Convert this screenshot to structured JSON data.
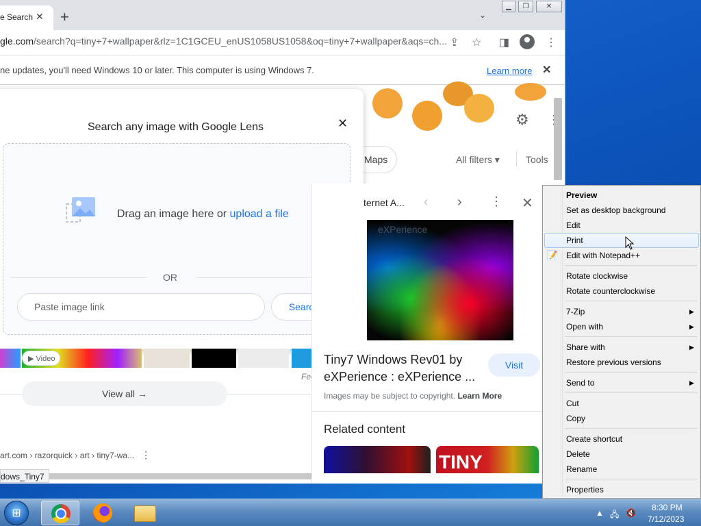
{
  "browser": {
    "tab_title": "e Search",
    "tab_close": "✕",
    "new_tab": "+",
    "url_host": "gle.com",
    "url_rest": "/search?q=tiny+7+wallpaper&rlz=1C1GCEU_enUS1058US1058&oq=tiny+7+wallpaper&aqs=ch...",
    "infobar_message": "ne updates, you'll need Windows 10 or later. This computer is using Windows 7.",
    "infobar_learn_more": "Learn more",
    "infobar_close": "✕"
  },
  "search_page": {
    "maps_chip": "Maps",
    "all_filters": "All filters ▾",
    "tools": "Tools",
    "lens": {
      "title": "Search any image with Google Lens",
      "drag_text": "Drag an image here or ",
      "upload_link": "upload a file",
      "or_text": "OR",
      "paste_placeholder": "Paste image link",
      "search_button": "Search"
    },
    "video_badge": "▶ Video",
    "feed_text": "Fee",
    "view_all": "View all  →",
    "cite": "art.com › razorquick › art › tiny7-wa...",
    "status_bubble": "dows_Tiny7"
  },
  "side_panel": {
    "source": "ternet A...",
    "watermark": "eXPerience",
    "title": "Tiny7 Windows Rev01 by eXPerience : eXPerience ...",
    "visit_button": "Visit",
    "copyright": "Images may be subject to copyright. ",
    "learn_more": "Learn More",
    "related_heading": "Related content",
    "related_2_text": "TINY"
  },
  "context_menu": {
    "items": [
      {
        "label": "Preview",
        "bold": true
      },
      {
        "label": "Set as desktop background"
      },
      {
        "label": "Edit"
      },
      {
        "label": "Print",
        "highlighted": true
      },
      {
        "label": "Edit with Notepad++"
      },
      {
        "label": "Rotate clockwise"
      },
      {
        "label": "Rotate counterclockwise"
      },
      {
        "label": "7-Zip",
        "submenu": true
      },
      {
        "label": "Open with",
        "submenu": true
      },
      {
        "label": "Share with",
        "submenu": true
      },
      {
        "label": "Restore previous versions"
      },
      {
        "label": "Send to",
        "submenu": true
      },
      {
        "label": "Cut"
      },
      {
        "label": "Copy"
      },
      {
        "label": "Create shortcut"
      },
      {
        "label": "Delete"
      },
      {
        "label": "Rename"
      },
      {
        "label": "Properties"
      }
    ]
  },
  "taskbar": {
    "time": "8:30 PM",
    "date": "7/12/2023"
  },
  "colors": {
    "link_blue": "#1a73e8",
    "desktop_blue": "#0f59c2",
    "menu_highlight": "#a8c8ef"
  }
}
